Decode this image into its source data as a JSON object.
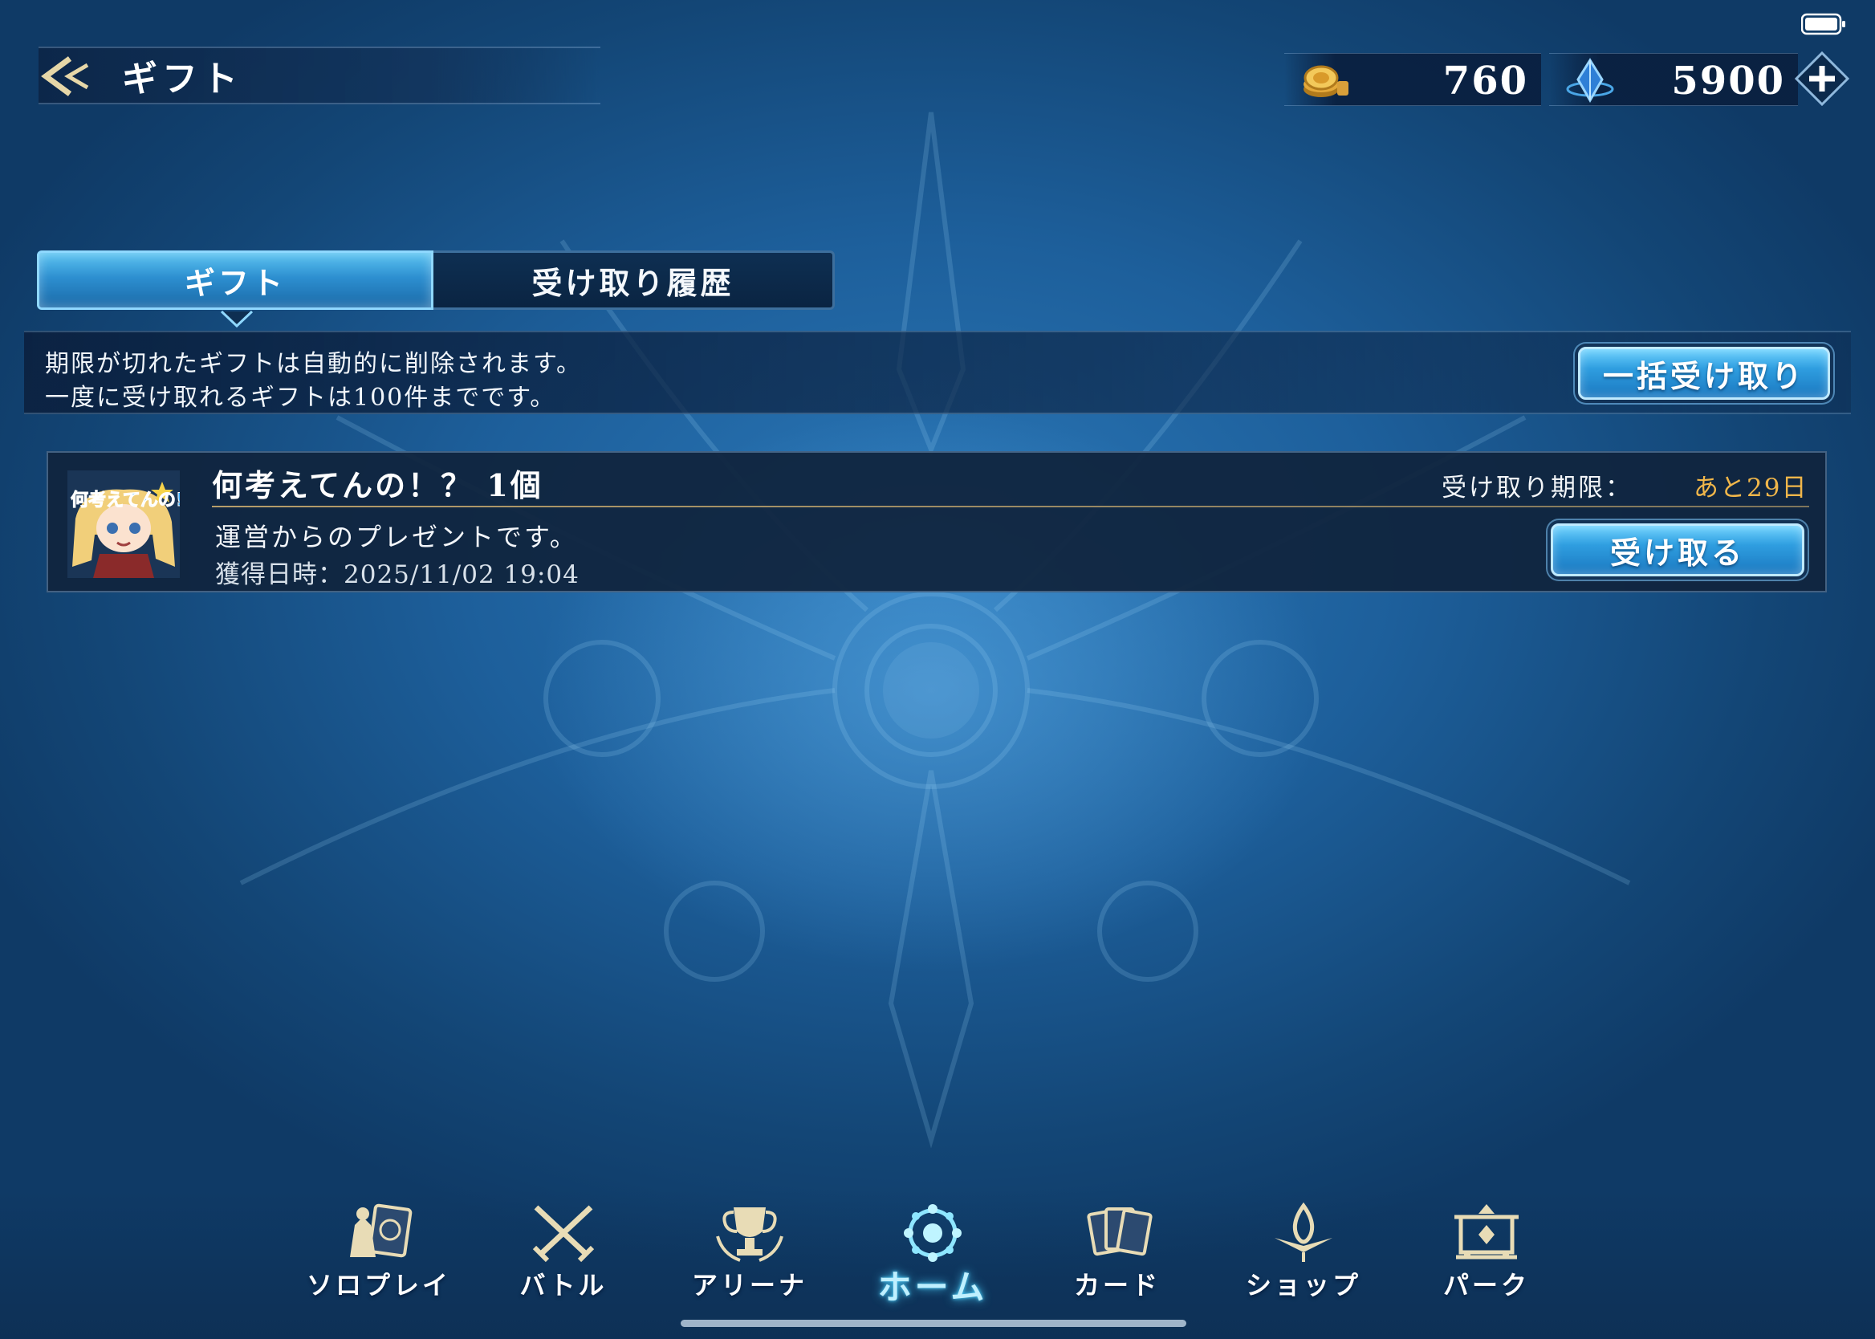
{
  "header": {
    "title": "ギフト",
    "gold_amount": "760",
    "gem_amount": "5900"
  },
  "tabs": [
    {
      "label": "ギフト",
      "active": true
    },
    {
      "label": "受け取り履歴",
      "active": false
    }
  ],
  "notice": {
    "line1": "期限が切れたギフトは自動的に削除されます。",
    "line2": "一度に受け取れるギフトは100件までです。",
    "bulk_button": "一括受け取り"
  },
  "gifts": [
    {
      "title": "何考えてんの！？ 1個",
      "deadline_label": "受け取り期限：",
      "deadline_value": "あと29日",
      "description": "運営からのプレゼントです。",
      "acquired": "獲得日時：2025/11/02 19:04",
      "receive_button": "受け取る",
      "avatar_text": "何考えてんの!?"
    }
  ],
  "nav": [
    {
      "label": "ソロプレイ",
      "icon": "solo-play-icon"
    },
    {
      "label": "バトル",
      "icon": "crossed-swords-icon"
    },
    {
      "label": "アリーナ",
      "icon": "trophy-icon"
    },
    {
      "label": "ホーム",
      "icon": "home-crest-icon",
      "active": true
    },
    {
      "label": "カード",
      "icon": "cards-icon"
    },
    {
      "label": "ショップ",
      "icon": "shop-icon"
    },
    {
      "label": "パーク",
      "icon": "park-icon"
    }
  ],
  "colors": {
    "accent": "#2f9ee0",
    "deadline": "#f0b64a",
    "background": "#1d5f9b"
  }
}
